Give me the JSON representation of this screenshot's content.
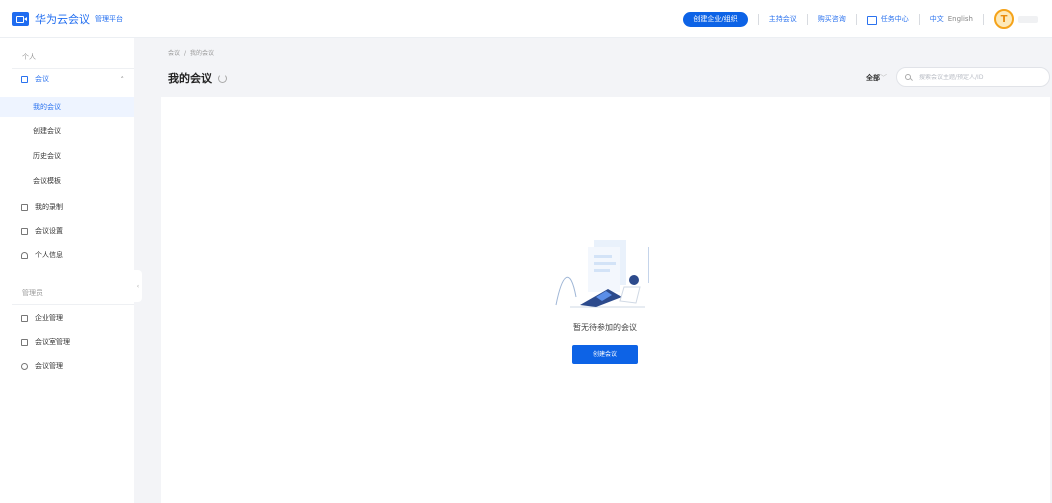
{
  "header": {
    "app_name": "华为云会议",
    "app_sub": "管理平台",
    "create_org": "创建企业/组织",
    "host_meeting": "主持会议",
    "purchase": "购买咨询",
    "task_center": "任务中心",
    "lang_zh": "中文",
    "lang_en": "English",
    "avatar_letter": "T"
  },
  "sidebar": {
    "personal_title": "个人",
    "meeting_group": "会议",
    "items": [
      "我的会议",
      "创建会议",
      "历史会议",
      "会议模板"
    ],
    "my_recordings": "我的录制",
    "meeting_settings": "会议设置",
    "personal_info": "个人信息",
    "admin_title": "管理员",
    "enterprise_mgmt": "企业管理",
    "room_mgmt": "会议室管理",
    "meeting_mgmt": "会议管理"
  },
  "main": {
    "breadcrumb_root": "会议",
    "breadcrumb_sep": "/",
    "breadcrumb_current": "我的会议",
    "title": "我的会议",
    "filter_label": "全部",
    "search_placeholder": "搜索会议主题/预定人/ID",
    "empty_text": "暂无待参加的会议",
    "create_button": "创建会议"
  },
  "colors": {
    "primary": "#0d63e6",
    "link": "#2a72ef",
    "avatar_ring": "#f5a31a"
  }
}
